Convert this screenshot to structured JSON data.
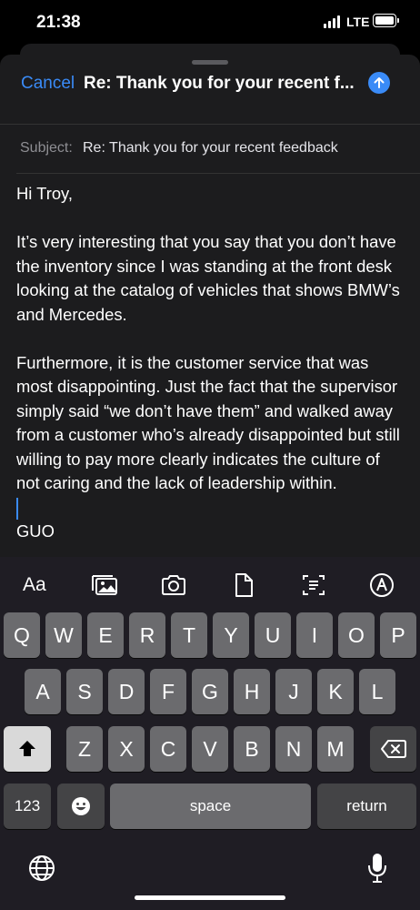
{
  "status_bar": {
    "time": "21:38",
    "network": "LTE",
    "battery_level": 1.0
  },
  "compose": {
    "cancel_label": "Cancel",
    "title": "Re: Thank you for your recent f...",
    "subject_label": "Subject:",
    "subject_value": "Re: Thank you for your recent feedback",
    "send_icon": "arrow-up-icon",
    "body_paragraphs": [
      "Hi Troy,",
      "It’s very interesting that you say that you don’t have the inventory since I was standing at the front desk looking at the catalog of vehicles that shows BMW’s and Mercedes.",
      "Furthermore, it is the customer service that was most disappointing. Just the fact that the supervisor simply said “we don’t have them” and walked away from a customer who’s already disappointed but still willing to pay more clearly indicates the culture of not caring and the lack of leadership within.",
      "GUO"
    ]
  },
  "keyboard": {
    "toolbar": {
      "format_label": "Aa"
    },
    "row1": [
      "Q",
      "W",
      "E",
      "R",
      "T",
      "Y",
      "U",
      "I",
      "O",
      "P"
    ],
    "row2": [
      "A",
      "S",
      "D",
      "F",
      "G",
      "H",
      "J",
      "K",
      "L"
    ],
    "row3": [
      "Z",
      "X",
      "C",
      "V",
      "B",
      "N",
      "M"
    ],
    "numbers_label": "123",
    "space_label": "space",
    "return_label": "return"
  },
  "colors": {
    "accent": "#3a8bf7",
    "key": "#6b6b6e",
    "key_dark": "#444446",
    "sheet": "#1c1c1e",
    "keyboard_bg": "#1f1d24"
  }
}
